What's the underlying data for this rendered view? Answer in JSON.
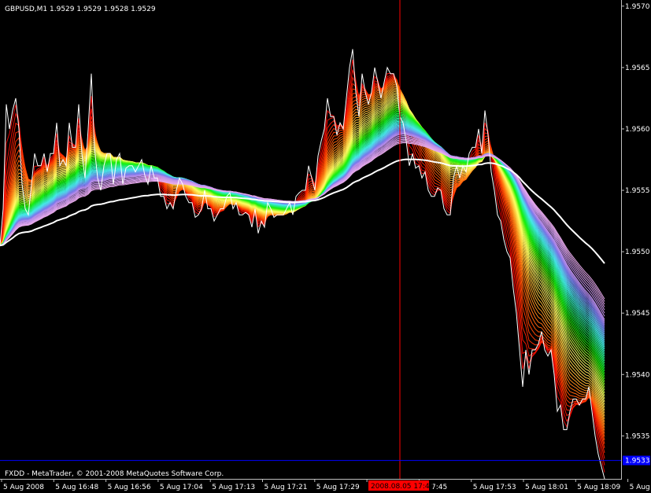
{
  "chart_data": {
    "type": "line",
    "title": "GBPUSD,M1  1.9529 1.9529 1.9528 1.9529",
    "symbol": "GBPUSD,M1",
    "ohlc": [
      "1.9529",
      "1.9529",
      "1.9528",
      "1.9529"
    ],
    "footer": "FXDD - MetaTrader, © 2001-2008 MetaQuotes Software Corp.",
    "ylim": [
      1.95315,
      1.95705
    ],
    "y_ticks": [
      "1.9570",
      "1.9565",
      "1.9560",
      "1.9555",
      "1.9550",
      "1.9545",
      "1.9540",
      "1.9535"
    ],
    "x_ticks": [
      "5 Aug 2008",
      "5 Aug 16:48",
      "5 Aug 16:56",
      "5 Aug 17:04",
      "5 Aug 17:13",
      "5 Aug 17:21",
      "5 Aug 17:29",
      "5 Aug",
      "7:45",
      "5 Aug 17:53",
      "5 Aug 18:01",
      "5 Aug 18:09",
      "5 Aug 18:17"
    ],
    "crosshair_time": "2008.08.05 17:44",
    "current_price": "1.9533",
    "current_price_level": 1.9533,
    "price_series": {
      "name": "Close",
      "x": [
        0,
        4,
        8,
        12,
        16,
        20,
        24,
        28,
        32,
        36,
        40,
        44,
        48,
        52,
        56,
        60,
        64,
        68,
        72,
        76,
        80,
        84,
        88,
        92,
        96,
        100,
        104,
        108,
        112,
        116,
        120,
        124,
        128,
        132,
        136,
        140,
        144,
        148,
        152,
        156,
        160,
        164,
        168,
        172,
        176,
        180,
        184,
        188,
        192,
        196,
        200,
        204,
        208,
        212,
        216,
        220,
        224,
        228,
        232,
        236,
        240,
        244,
        248,
        252,
        256,
        260,
        264,
        268,
        272,
        276,
        280,
        284,
        288,
        292,
        296,
        300,
        304,
        308,
        312,
        316,
        320,
        324,
        328,
        332,
        336,
        340,
        344,
        348,
        352,
        356,
        360,
        364,
        368,
        372,
        376,
        380,
        384,
        388,
        392,
        396,
        400,
        404,
        408,
        412,
        416,
        420,
        424,
        428,
        432,
        436,
        440,
        444,
        448,
        452,
        456,
        460,
        464,
        468,
        472,
        476,
        480,
        484,
        488,
        492,
        496,
        500,
        504,
        508,
        512,
        516,
        520,
        524,
        528,
        532,
        536,
        540,
        544,
        548,
        552,
        556,
        560,
        564,
        568,
        572,
        576,
        580,
        584,
        588,
        592,
        596,
        600,
        604,
        608,
        612,
        616,
        620,
        624,
        628,
        632,
        636,
        640,
        644,
        648,
        652,
        656,
        660,
        664,
        668,
        672,
        676,
        680,
        684,
        688,
        692,
        696,
        700,
        704,
        708,
        712,
        716,
        720,
        724,
        728,
        732,
        736,
        740,
        744,
        748,
        752,
        756,
        760,
        764,
        768,
        772,
        776,
        780,
        784,
        788
      ],
      "y": [
        1.95505,
        1.95535,
        1.9562,
        1.956,
        1.95615,
        1.95625,
        1.956,
        1.95555,
        1.95535,
        1.9553,
        1.95555,
        1.9558,
        1.9557,
        1.9557,
        1.9558,
        1.95565,
        1.9558,
        1.9558,
        1.95605,
        1.9557,
        1.95575,
        1.9557,
        1.95605,
        1.95585,
        1.95585,
        1.9562,
        1.9558,
        1.9556,
        1.956,
        1.95645,
        1.95585,
        1.9556,
        1.9555,
        1.9557,
        1.9558,
        1.9558,
        1.95555,
        1.95575,
        1.9558,
        1.95555,
        1.95568,
        1.9557,
        1.9557,
        1.95565,
        1.9557,
        1.95575,
        1.95562,
        1.95555,
        1.9557,
        1.9556,
        1.9556,
        1.95545,
        1.95545,
        1.95535,
        1.9554,
        1.95535,
        1.9555,
        1.9556,
        1.95555,
        1.95545,
        1.9554,
        1.9554,
        1.95528,
        1.9553,
        1.95535,
        1.9555,
        1.95535,
        1.95535,
        1.95525,
        1.9553,
        1.95535,
        1.95535,
        1.95545,
        1.95548,
        1.95535,
        1.9554,
        1.9553,
        1.9553,
        1.95532,
        1.9553,
        1.9552,
        1.95535,
        1.95515,
        1.95525,
        1.9552,
        1.9554,
        1.95535,
        1.95528,
        1.9553,
        1.9553,
        1.9553,
        1.95535,
        1.9554,
        1.9553,
        1.95545,
        1.95548,
        1.9555,
        1.9555,
        1.9557,
        1.9556,
        1.9555,
        1.95578,
        1.9559,
        1.956,
        1.95625,
        1.9561,
        1.9561,
        1.95595,
        1.95605,
        1.956,
        1.95625,
        1.9565,
        1.95665,
        1.9563,
        1.9561,
        1.95645,
        1.9563,
        1.9562,
        1.9563,
        1.9565,
        1.95638,
        1.95625,
        1.95638,
        1.9565,
        1.95645,
        1.95645,
        1.95635,
        1.9561,
        1.95605,
        1.9559,
        1.9557,
        1.9558,
        1.95568,
        1.9557,
        1.9556,
        1.95565,
        1.9555,
        1.95545,
        1.95545,
        1.95552,
        1.9555,
        1.95535,
        1.9553,
        1.9553,
        1.9556,
        1.9557,
        1.9556,
        1.9557,
        1.95565,
        1.9558,
        1.95585,
        1.95585,
        1.956,
        1.9558,
        1.95615,
        1.95595,
        1.95565,
        1.9555,
        1.9553,
        1.95525,
        1.9551,
        1.955,
        1.95495,
        1.9547,
        1.9545,
        1.9542,
        1.9539,
        1.9542,
        1.954,
        1.9542,
        1.9542,
        1.95425,
        1.95435,
        1.9542,
        1.95415,
        1.9542,
        1.954,
        1.9537,
        1.95375,
        1.95355,
        1.95355,
        1.9537,
        1.9538,
        1.9538,
        1.95375,
        1.9538,
        1.9538,
        1.9539,
        1.9537,
        1.9535,
        1.95335,
        1.95325,
        1.95315
      ]
    },
    "ribbon_periods": [
      2,
      3,
      4,
      5,
      6,
      7,
      8,
      9,
      10,
      11,
      12,
      13,
      14,
      15,
      16,
      17,
      18,
      19,
      20,
      21,
      22,
      23,
      24,
      25,
      26,
      27,
      28,
      29,
      30,
      31,
      32,
      33,
      34,
      35,
      36,
      37,
      38,
      39,
      40,
      41,
      42,
      43,
      44,
      45,
      46,
      47,
      48,
      49,
      50,
      51,
      52,
      53,
      54,
      55,
      56,
      58,
      60,
      62,
      64,
      66,
      68,
      70
    ],
    "colors": {
      "background": "#000000",
      "axis": "#c0c0c0",
      "grid_text": "#ffffff",
      "price_line": "#ffffff",
      "slow_ma": "#ffffff",
      "crosshair": "#ff0000",
      "price_level": "#0000ff",
      "time_label_bg": "#ff0000",
      "price_label_bg": "#0000ff"
    }
  }
}
